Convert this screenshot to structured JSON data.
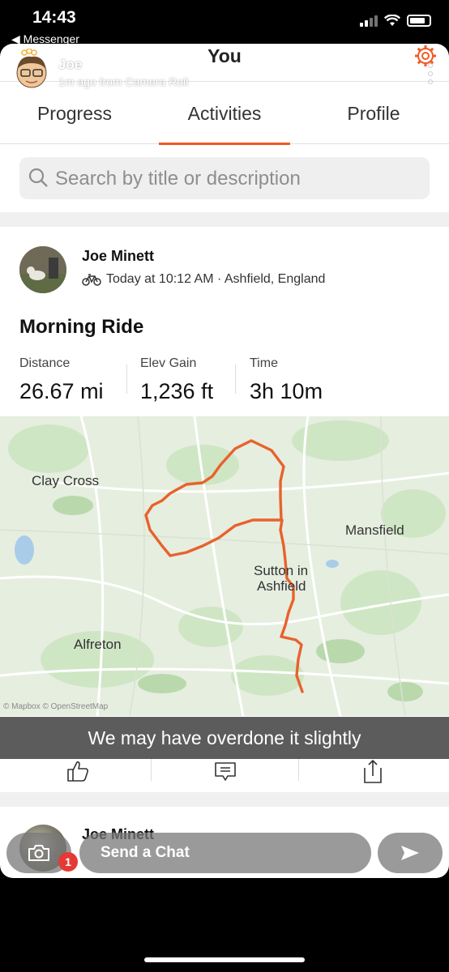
{
  "status": {
    "time": "14:43",
    "back_label": "◀ Messenger"
  },
  "header": {
    "title": "You"
  },
  "tabs": [
    {
      "label": "Progress"
    },
    {
      "label": "Activities"
    },
    {
      "label": "Profile"
    }
  ],
  "search": {
    "placeholder": "Search by title or description"
  },
  "activity": {
    "author": "Joe Minett",
    "meta": "Today at 10:12 AM · Ashfield, England",
    "title": "Morning Ride",
    "stats": [
      {
        "label": "Distance",
        "value": "26.67 mi"
      },
      {
        "label": "Elev Gain",
        "value": "1,236 ft"
      },
      {
        "label": "Time",
        "value": "3h 10m"
      }
    ],
    "map_labels": {
      "clay_cross": "Clay Cross",
      "mansfield": "Mansfield",
      "sutton_1": "Sutton in",
      "sutton_2": "Ashfield",
      "alfreton": "Alfreton",
      "attribution": "© Mapbox © OpenStreetMap"
    }
  },
  "next_activity": {
    "author": "Joe Minett"
  },
  "snap": {
    "name": "Joe",
    "subtitle": "1m ago from Camera Roll",
    "caption": "We may have overdone it slightly",
    "chat_placeholder": "Send a Chat",
    "badge_count": "1"
  },
  "colors": {
    "accent": "#f15a24",
    "route": "#e8622c"
  }
}
